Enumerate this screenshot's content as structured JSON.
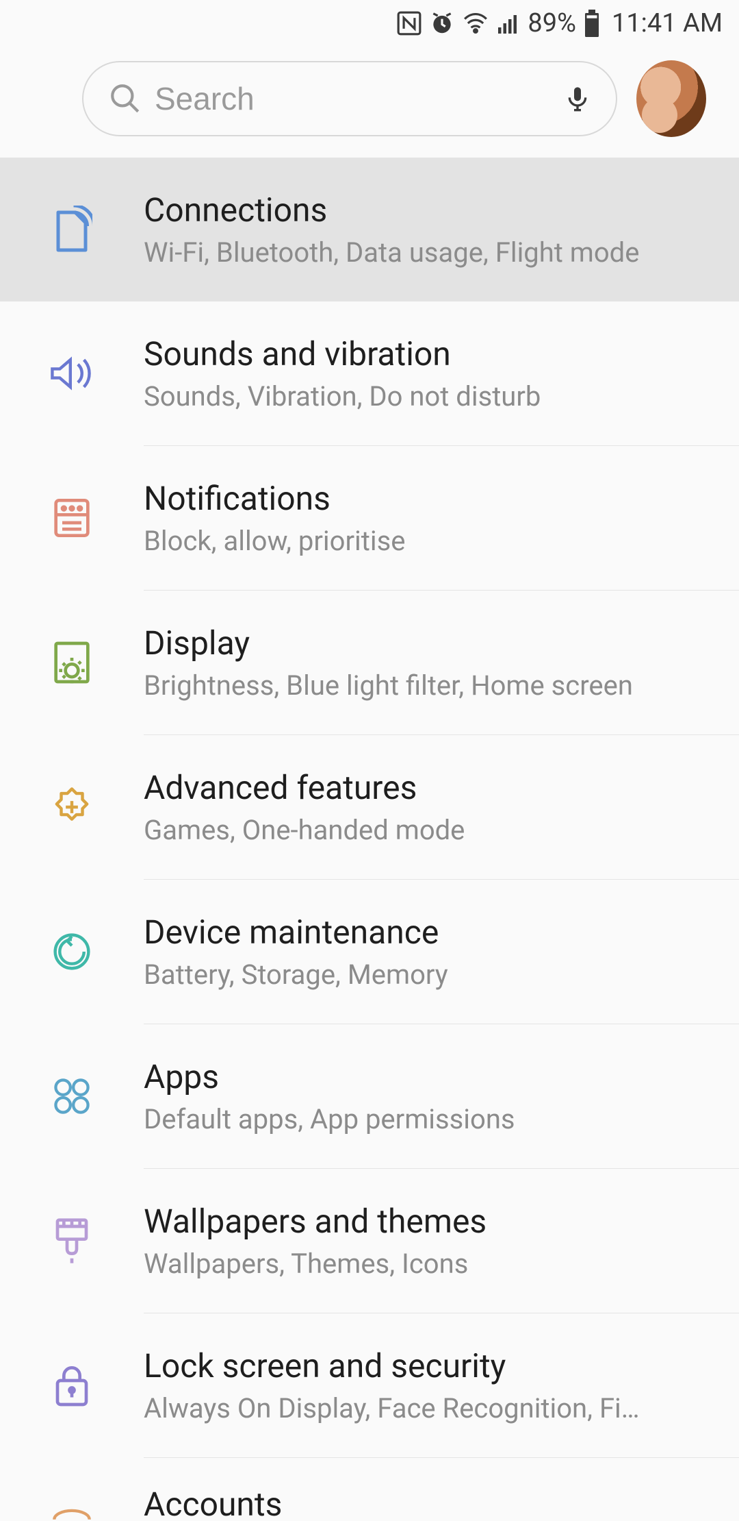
{
  "status_bar": {
    "battery_pct": "89%",
    "time": "11:41 AM"
  },
  "search": {
    "placeholder": "Search"
  },
  "items": [
    {
      "id": "connections",
      "title": "Connections",
      "subtitle": "Wi-Fi, Bluetooth, Data usage, Flight mode",
      "selected": true
    },
    {
      "id": "sounds",
      "title": "Sounds and vibration",
      "subtitle": "Sounds, Vibration, Do not disturb"
    },
    {
      "id": "notifications",
      "title": "Notifications",
      "subtitle": "Block, allow, prioritise"
    },
    {
      "id": "display",
      "title": "Display",
      "subtitle": "Brightness, Blue light filter, Home screen"
    },
    {
      "id": "advanced",
      "title": "Advanced features",
      "subtitle": "Games, One-handed mode"
    },
    {
      "id": "maintenance",
      "title": "Device maintenance",
      "subtitle": "Battery, Storage, Memory"
    },
    {
      "id": "apps",
      "title": "Apps",
      "subtitle": "Default apps, App permissions"
    },
    {
      "id": "wallpapers",
      "title": "Wallpapers and themes",
      "subtitle": "Wallpapers, Themes, Icons"
    },
    {
      "id": "lockscreen",
      "title": "Lock screen and security",
      "subtitle": "Always On Display, Face Recognition, Fi…"
    },
    {
      "id": "accounts",
      "title": "Accounts",
      "subtitle": ""
    }
  ]
}
